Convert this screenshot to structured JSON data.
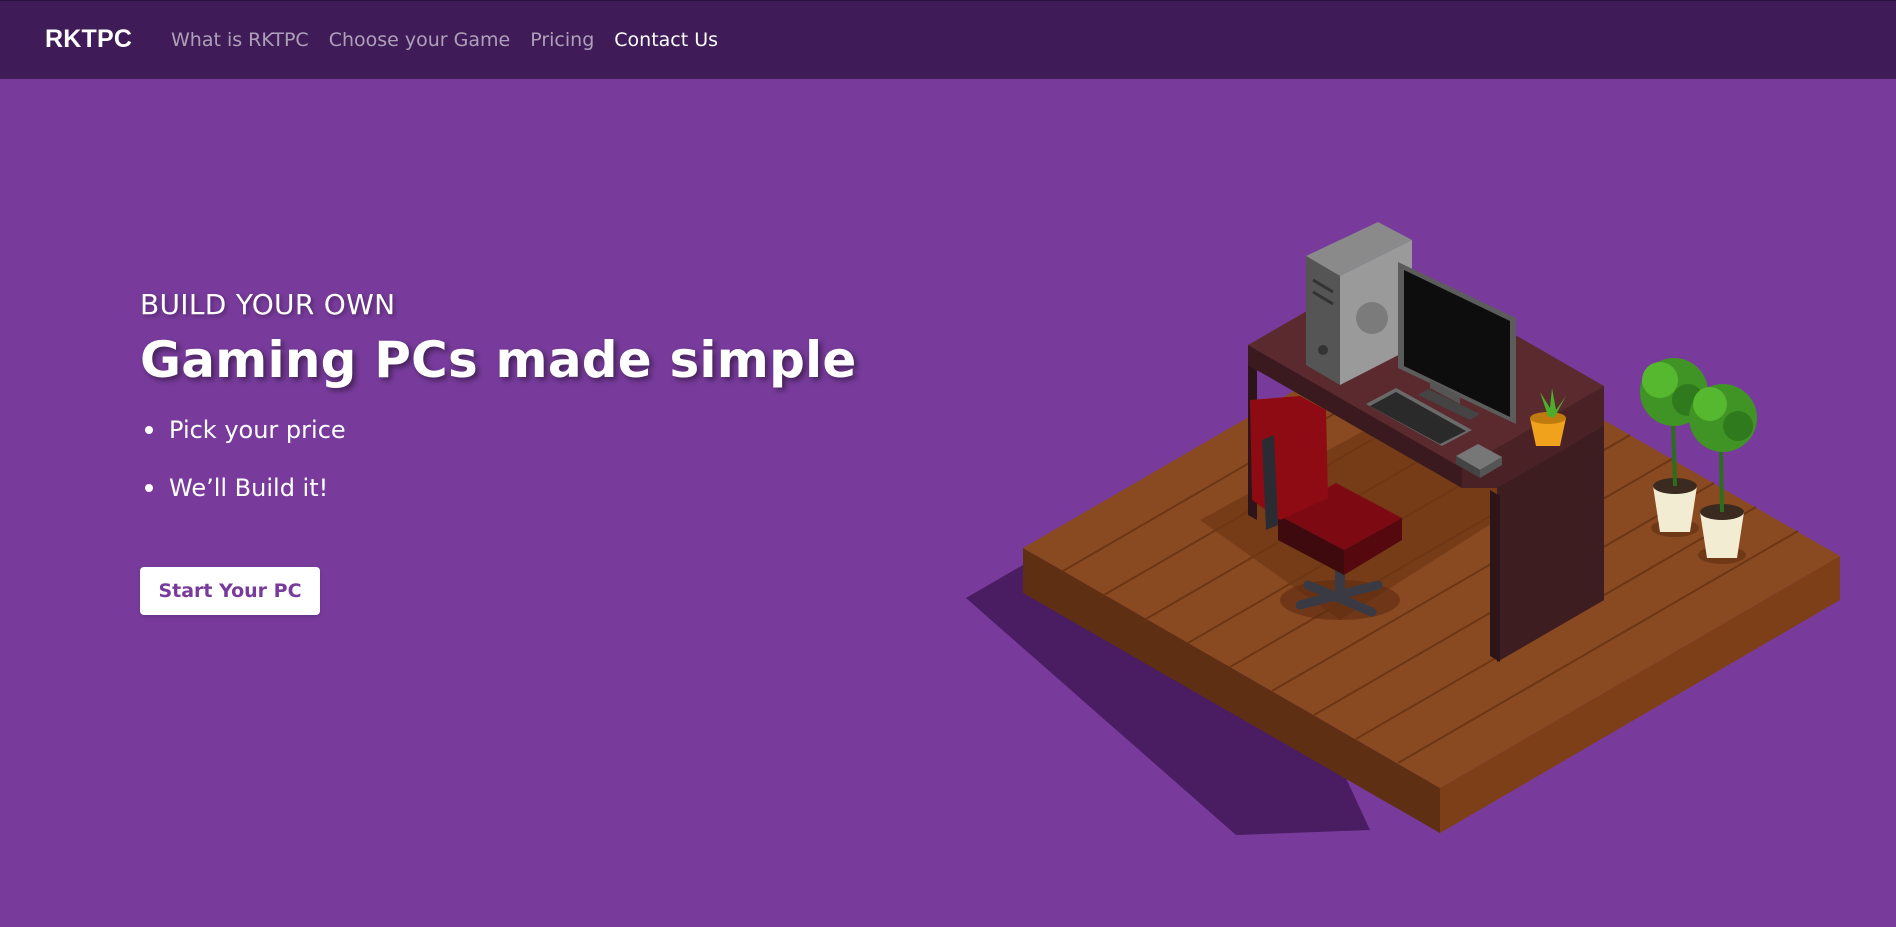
{
  "nav": {
    "brand": "RKTPC",
    "links": [
      {
        "label": "What is RKTPC"
      },
      {
        "label": "Choose your Game"
      },
      {
        "label": "Pricing"
      },
      {
        "label": "Contact Us"
      }
    ]
  },
  "hero": {
    "eyebrow": "BUILD YOUR OWN",
    "headline": "Gaming PCs made simple",
    "features": [
      "Pick your price",
      "We’ll Build it!"
    ],
    "cta_label": "Start Your PC"
  },
  "colors": {
    "background": "#783b9c",
    "navbar": "#3f1b58",
    "accent": "#783b9c",
    "text": "#ffffff"
  },
  "illustration": {
    "subject": "isometric gaming desk setup",
    "icons": [
      "pc-tower-icon",
      "monitor-icon",
      "keyboard-icon",
      "mouse-icon",
      "desk-chair-icon",
      "potted-plant-icon"
    ]
  }
}
